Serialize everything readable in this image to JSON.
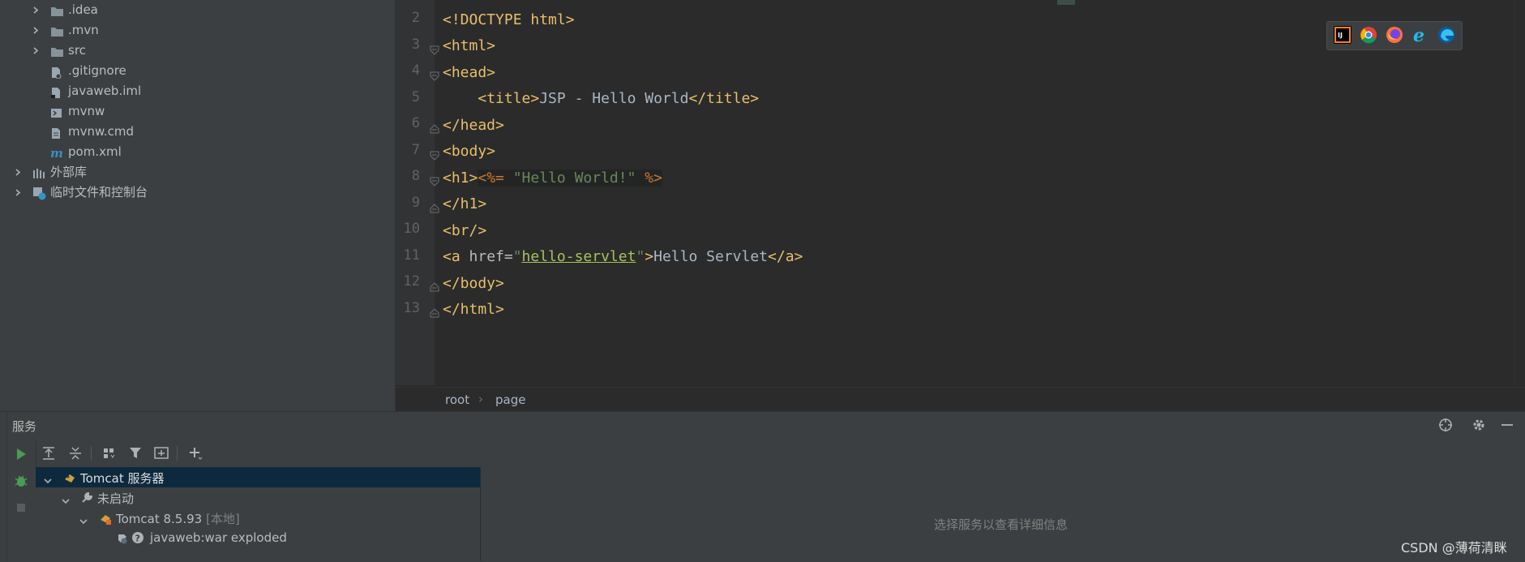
{
  "project_tree": {
    "items": [
      {
        "label": ".idea",
        "icon": "folder-icon"
      },
      {
        "label": ".mvn",
        "icon": "folder-icon"
      },
      {
        "label": "src",
        "icon": "folder-icon"
      },
      {
        "label": ".gitignore",
        "icon": "gitignore-file-icon"
      },
      {
        "label": "javaweb.iml",
        "icon": "iml-file-icon"
      },
      {
        "label": "mvnw",
        "icon": "script-file-icon"
      },
      {
        "label": "mvnw.cmd",
        "icon": "text-file-icon"
      },
      {
        "label": "pom.xml",
        "icon": "maven-file-icon"
      },
      {
        "label": "外部库",
        "icon": "library-icon"
      },
      {
        "label": "临时文件和控制台",
        "icon": "scratch-icon"
      }
    ]
  },
  "editor": {
    "line_numbers": [
      "2",
      "3",
      "4",
      "5",
      "6",
      "7",
      "8",
      "9",
      "10",
      "11",
      "12",
      "13"
    ],
    "lines": {
      "l2": {
        "t": "<!DOCTYPE html>"
      },
      "l3": {
        "t": "<html>"
      },
      "l4": {
        "t": "<head>"
      },
      "l5": {
        "indent": "    ",
        "open": "<title>",
        "text": "JSP - Hello World",
        "close": "</title>"
      },
      "l6": {
        "t": "</head>"
      },
      "l7": {
        "t": "<body>"
      },
      "l8": {
        "open": "<h1>",
        "jsp_open": "<%= ",
        "str": "\"Hello World!\"",
        "jsp_close": " %>"
      },
      "l9": {
        "t": "</h1>"
      },
      "l10": {
        "t": "<br/>"
      },
      "l11": {
        "open": "<a ",
        "attr": "href=",
        "q1": "\"",
        "link": "hello-servlet",
        "q2": "\"",
        "gt": ">",
        "text": "Hello Servlet",
        "close": "</a>"
      },
      "l12": {
        "t": "</body>"
      },
      "l13": {
        "t": "</html>"
      }
    },
    "browsers": [
      "intellij-icon",
      "chrome-icon",
      "firefox-icon",
      "ie-icon",
      "edge-icon"
    ]
  },
  "breadcrumb": {
    "root": "root",
    "sep": "›",
    "page": "page"
  },
  "services": {
    "title": "服务",
    "detail_placeholder": "选择服务以查看详细信息",
    "tree": [
      {
        "label": "Tomcat 服务器"
      },
      {
        "label": "未启动"
      },
      {
        "label": "Tomcat 8.5.93",
        "suffix": "[本地]"
      },
      {
        "label": "javaweb:war exploded"
      }
    ]
  },
  "watermark": "CSDN @薄荷清眯",
  "colors": {
    "accent_green": "#499c54",
    "tag": "#e8bf6a",
    "string": "#6a8759",
    "selection": "#0d293e"
  }
}
